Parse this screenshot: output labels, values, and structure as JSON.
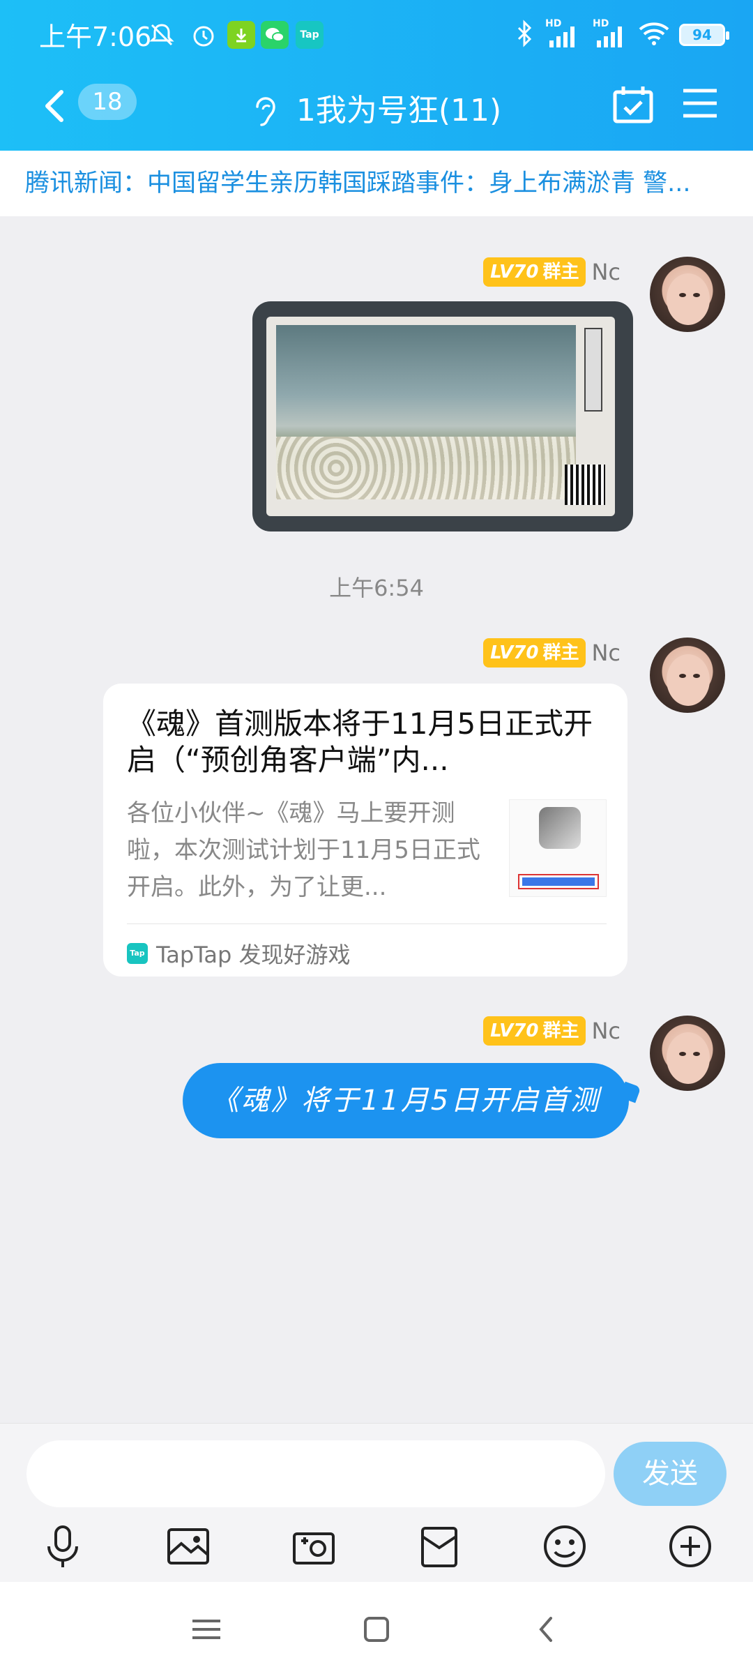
{
  "status_bar": {
    "time": "上午7:06",
    "tap_label": "Tap",
    "battery": "94",
    "hd1": "HD",
    "hd2": "HD"
  },
  "navbar": {
    "back_badge": "18",
    "title": "1我为号狂(11)"
  },
  "news": {
    "text": "腾讯新闻：中国留学生亲历韩国踩踏事件：身上布满淤青 警..."
  },
  "messages": [
    {
      "type": "image",
      "level": "LV70",
      "role": "群主",
      "nick": "Nc"
    },
    {
      "type": "timestamp",
      "time": "上午6:54"
    },
    {
      "type": "link_card",
      "level": "LV70",
      "role": "群主",
      "nick": "Nc",
      "title": "《魂》首测版本将于11月5日正式开启（“预创角客户端”内...",
      "description": "各位小伙伴~《魂》马上要开测啦，本次测试计划于11月5日正式开启。此外，为了让更...",
      "source": "TapTap 发现好游戏",
      "source_icon_label": "Tap"
    },
    {
      "type": "text",
      "level": "LV70",
      "role": "群主",
      "nick": "Nc",
      "text": "《魂》将于11月5日开启首测"
    }
  ],
  "input": {
    "value": "",
    "placeholder": "",
    "send_label": "发送"
  },
  "toolbar": {
    "icons": [
      "microphone-icon",
      "image-icon",
      "camera-icon",
      "red-packet-icon",
      "emoji-icon",
      "plus-icon"
    ]
  },
  "colors": {
    "header_start": "#1dbff7",
    "header_end": "#1aa6f3",
    "bubble": "#1c93f0",
    "level_badge": "#ffc21a",
    "send_button": "#8fd0f6"
  }
}
